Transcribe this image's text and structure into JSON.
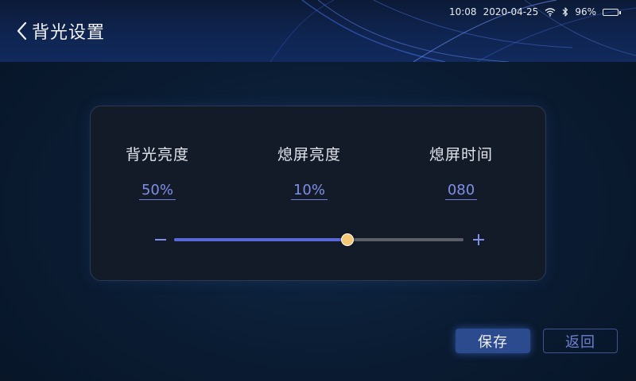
{
  "header": {
    "title": "背光设置"
  },
  "status": {
    "time": "10:08",
    "date": "2020-04-25",
    "battery": "96%",
    "battery_level": 0.96,
    "icons": [
      "wifi-icon",
      "bluetooth-icon",
      "battery-icon"
    ]
  },
  "settings": {
    "columns": [
      {
        "label": "背光亮度",
        "value": "50%"
      },
      {
        "label": "熄屏亮度",
        "value": "10%"
      },
      {
        "label": "熄屏时间",
        "value": "080"
      }
    ],
    "slider": {
      "level": 0.6
    }
  },
  "buttons": {
    "save_label": "保存",
    "back_label": "返回"
  },
  "colors": {
    "accent": "#7f8fe8",
    "slider_fill": "#5868d8",
    "thumb": "#f5c878",
    "save_bg": "#2c4a8e"
  }
}
